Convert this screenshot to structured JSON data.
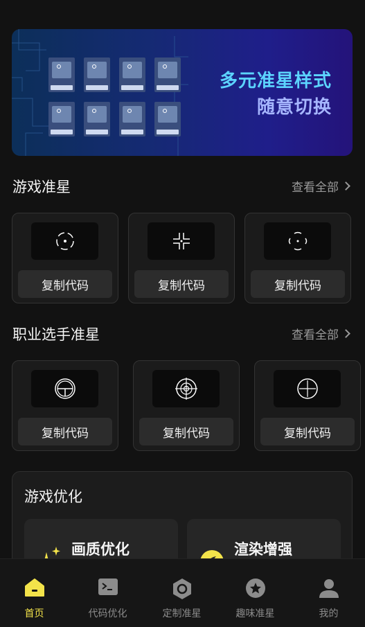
{
  "banner": {
    "line1": "多元准星样式",
    "line2": "随意切换"
  },
  "game_section": {
    "title": "游戏准星",
    "view_all": "查看全部",
    "cards": [
      {
        "icon": "crosshair-dashed-circle-icon",
        "button": "复制代码"
      },
      {
        "icon": "crosshair-corners-icon",
        "button": "复制代码"
      },
      {
        "icon": "crosshair-brackets-icon",
        "button": "复制代码"
      }
    ]
  },
  "pro_section": {
    "title": "职业选手准星",
    "view_all": "查看全部",
    "cards": [
      {
        "icon": "crosshair-t-circle-icon",
        "button": "复制代码"
      },
      {
        "icon": "crosshair-target-rings-icon",
        "button": "复制代码"
      },
      {
        "icon": "crosshair-circle-cross-icon",
        "button": "复制代码"
      }
    ]
  },
  "optimize": {
    "title": "游戏优化",
    "items": [
      {
        "label": "画质优化",
        "icon": "sparkle-icon"
      },
      {
        "label": "渲染增强",
        "icon": "render-icon"
      }
    ]
  },
  "tabs": [
    {
      "label": "首页",
      "icon": "home-icon",
      "active": true
    },
    {
      "label": "代码优化",
      "icon": "terminal-icon",
      "active": false
    },
    {
      "label": "定制准星",
      "icon": "hexagon-icon",
      "active": false
    },
    {
      "label": "趣味准星",
      "icon": "star-circle-icon",
      "active": false
    },
    {
      "label": "我的",
      "icon": "user-icon",
      "active": false
    }
  ],
  "colors": {
    "accent": "#f3e34a",
    "background": "#121212",
    "card": "#1b1b1b"
  }
}
